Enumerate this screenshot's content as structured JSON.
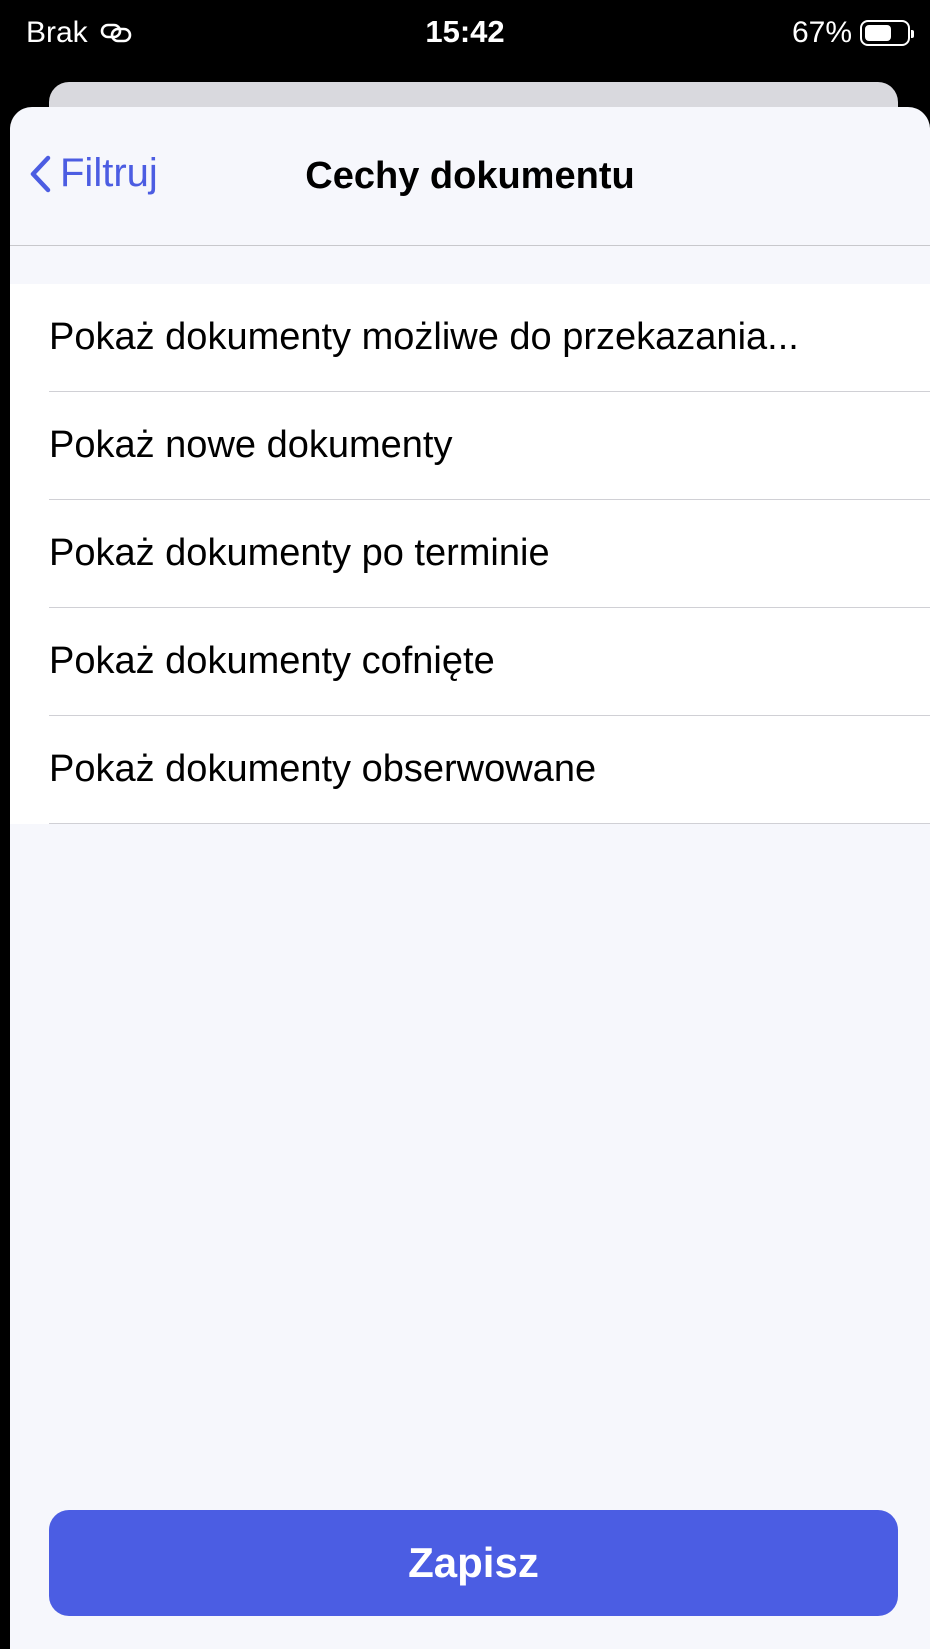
{
  "status_bar": {
    "carrier": "Brak",
    "time": "15:42",
    "battery_percent_label": "67%",
    "battery_level": 0.67
  },
  "nav": {
    "back_label": "Filtruj",
    "title": "Cechy dokumentu"
  },
  "options": [
    {
      "label": "Pokaż dokumenty możliwe do przekazania..."
    },
    {
      "label": "Pokaż nowe dokumenty"
    },
    {
      "label": "Pokaż dokumenty po terminie"
    },
    {
      "label": "Pokaż dokumenty cofnięte"
    },
    {
      "label": "Pokaż dokumenty obserwowane"
    }
  ],
  "actions": {
    "save_label": "Zapisz"
  },
  "colors": {
    "accent": "#4b5de3",
    "sheet_background": "#f6f7fc",
    "separator": "#d0d0d5"
  },
  "icons": {
    "link": "link-icon",
    "battery": "battery-icon",
    "back": "chevron-left-icon"
  }
}
